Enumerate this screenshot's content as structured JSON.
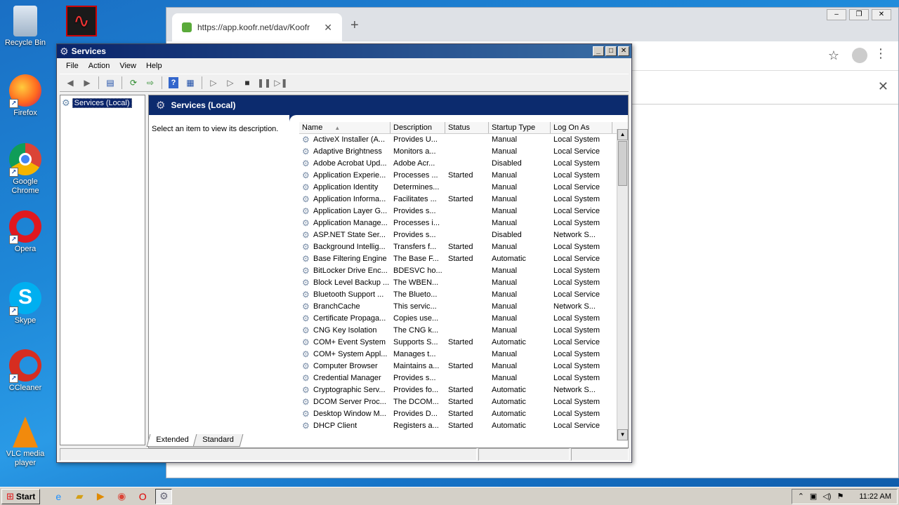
{
  "desktop": {
    "icons": [
      {
        "label": "Recycle Bin",
        "icon": "recycle-bin-icon"
      },
      {
        "label": "Firefox",
        "icon": "firefox-icon"
      },
      {
        "label": "Google Chrome",
        "icon": "chrome-icon"
      },
      {
        "label": "Opera",
        "icon": "opera-icon"
      },
      {
        "label": "Skype",
        "icon": "skype-icon"
      },
      {
        "label": "CCleaner",
        "icon": "ccleaner-icon"
      },
      {
        "label": "VLC media player",
        "icon": "vlc-icon"
      }
    ],
    "watermark": "ANY RUN"
  },
  "chrome": {
    "tab_title": "https://app.koofr.net/dav/Koofr",
    "new_tab": "+",
    "close_tab": "✕"
  },
  "services": {
    "title": "Services",
    "menu": [
      "File",
      "Action",
      "View",
      "Help"
    ],
    "tree_item": "Services (Local)",
    "pane_title": "Services (Local)",
    "description_hint": "Select an item to view its description.",
    "columns": [
      "Name",
      "Description",
      "Status",
      "Startup Type",
      "Log On As"
    ],
    "rows": [
      [
        "ActiveX Installer (A...",
        "Provides U...",
        "",
        "Manual",
        "Local System"
      ],
      [
        "Adaptive Brightness",
        "Monitors a...",
        "",
        "Manual",
        "Local Service"
      ],
      [
        "Adobe Acrobat Upd...",
        "Adobe Acr...",
        "",
        "Disabled",
        "Local System"
      ],
      [
        "Application Experie...",
        "Processes ...",
        "Started",
        "Manual",
        "Local System"
      ],
      [
        "Application Identity",
        "Determines...",
        "",
        "Manual",
        "Local Service"
      ],
      [
        "Application Informa...",
        "Facilitates ...",
        "Started",
        "Manual",
        "Local System"
      ],
      [
        "Application Layer G...",
        "Provides s...",
        "",
        "Manual",
        "Local Service"
      ],
      [
        "Application Manage...",
        "Processes i...",
        "",
        "Manual",
        "Local System"
      ],
      [
        "ASP.NET State Ser...",
        "Provides s...",
        "",
        "Disabled",
        "Network S..."
      ],
      [
        "Background Intellig...",
        "Transfers f...",
        "Started",
        "Manual",
        "Local System"
      ],
      [
        "Base Filtering Engine",
        "The Base F...",
        "Started",
        "Automatic",
        "Local Service"
      ],
      [
        "BitLocker Drive Enc...",
        "BDESVC ho...",
        "",
        "Manual",
        "Local System"
      ],
      [
        "Block Level Backup ...",
        "The WBEN...",
        "",
        "Manual",
        "Local System"
      ],
      [
        "Bluetooth Support ...",
        "The Blueto...",
        "",
        "Manual",
        "Local Service"
      ],
      [
        "BranchCache",
        "This servic...",
        "",
        "Manual",
        "Network S..."
      ],
      [
        "Certificate Propaga...",
        "Copies use...",
        "",
        "Manual",
        "Local System"
      ],
      [
        "CNG Key Isolation",
        "The CNG k...",
        "",
        "Manual",
        "Local System"
      ],
      [
        "COM+ Event System",
        "Supports S...",
        "Started",
        "Automatic",
        "Local Service"
      ],
      [
        "COM+ System Appl...",
        "Manages t...",
        "",
        "Manual",
        "Local System"
      ],
      [
        "Computer Browser",
        "Maintains a...",
        "Started",
        "Manual",
        "Local System"
      ],
      [
        "Credential Manager",
        "Provides s...",
        "",
        "Manual",
        "Local System"
      ],
      [
        "Cryptographic Serv...",
        "Provides fo...",
        "Started",
        "Automatic",
        "Network S..."
      ],
      [
        "DCOM Server Proc...",
        "The DCOM...",
        "Started",
        "Automatic",
        "Local System"
      ],
      [
        "Desktop Window M...",
        "Provides D...",
        "Started",
        "Automatic",
        "Local System"
      ],
      [
        "DHCP Client",
        "Registers a...",
        "Started",
        "Automatic",
        "Local Service"
      ]
    ],
    "tabs": [
      "Extended",
      "Standard"
    ]
  },
  "taskbar": {
    "start_label": "Start",
    "clock": "11:22 AM"
  }
}
